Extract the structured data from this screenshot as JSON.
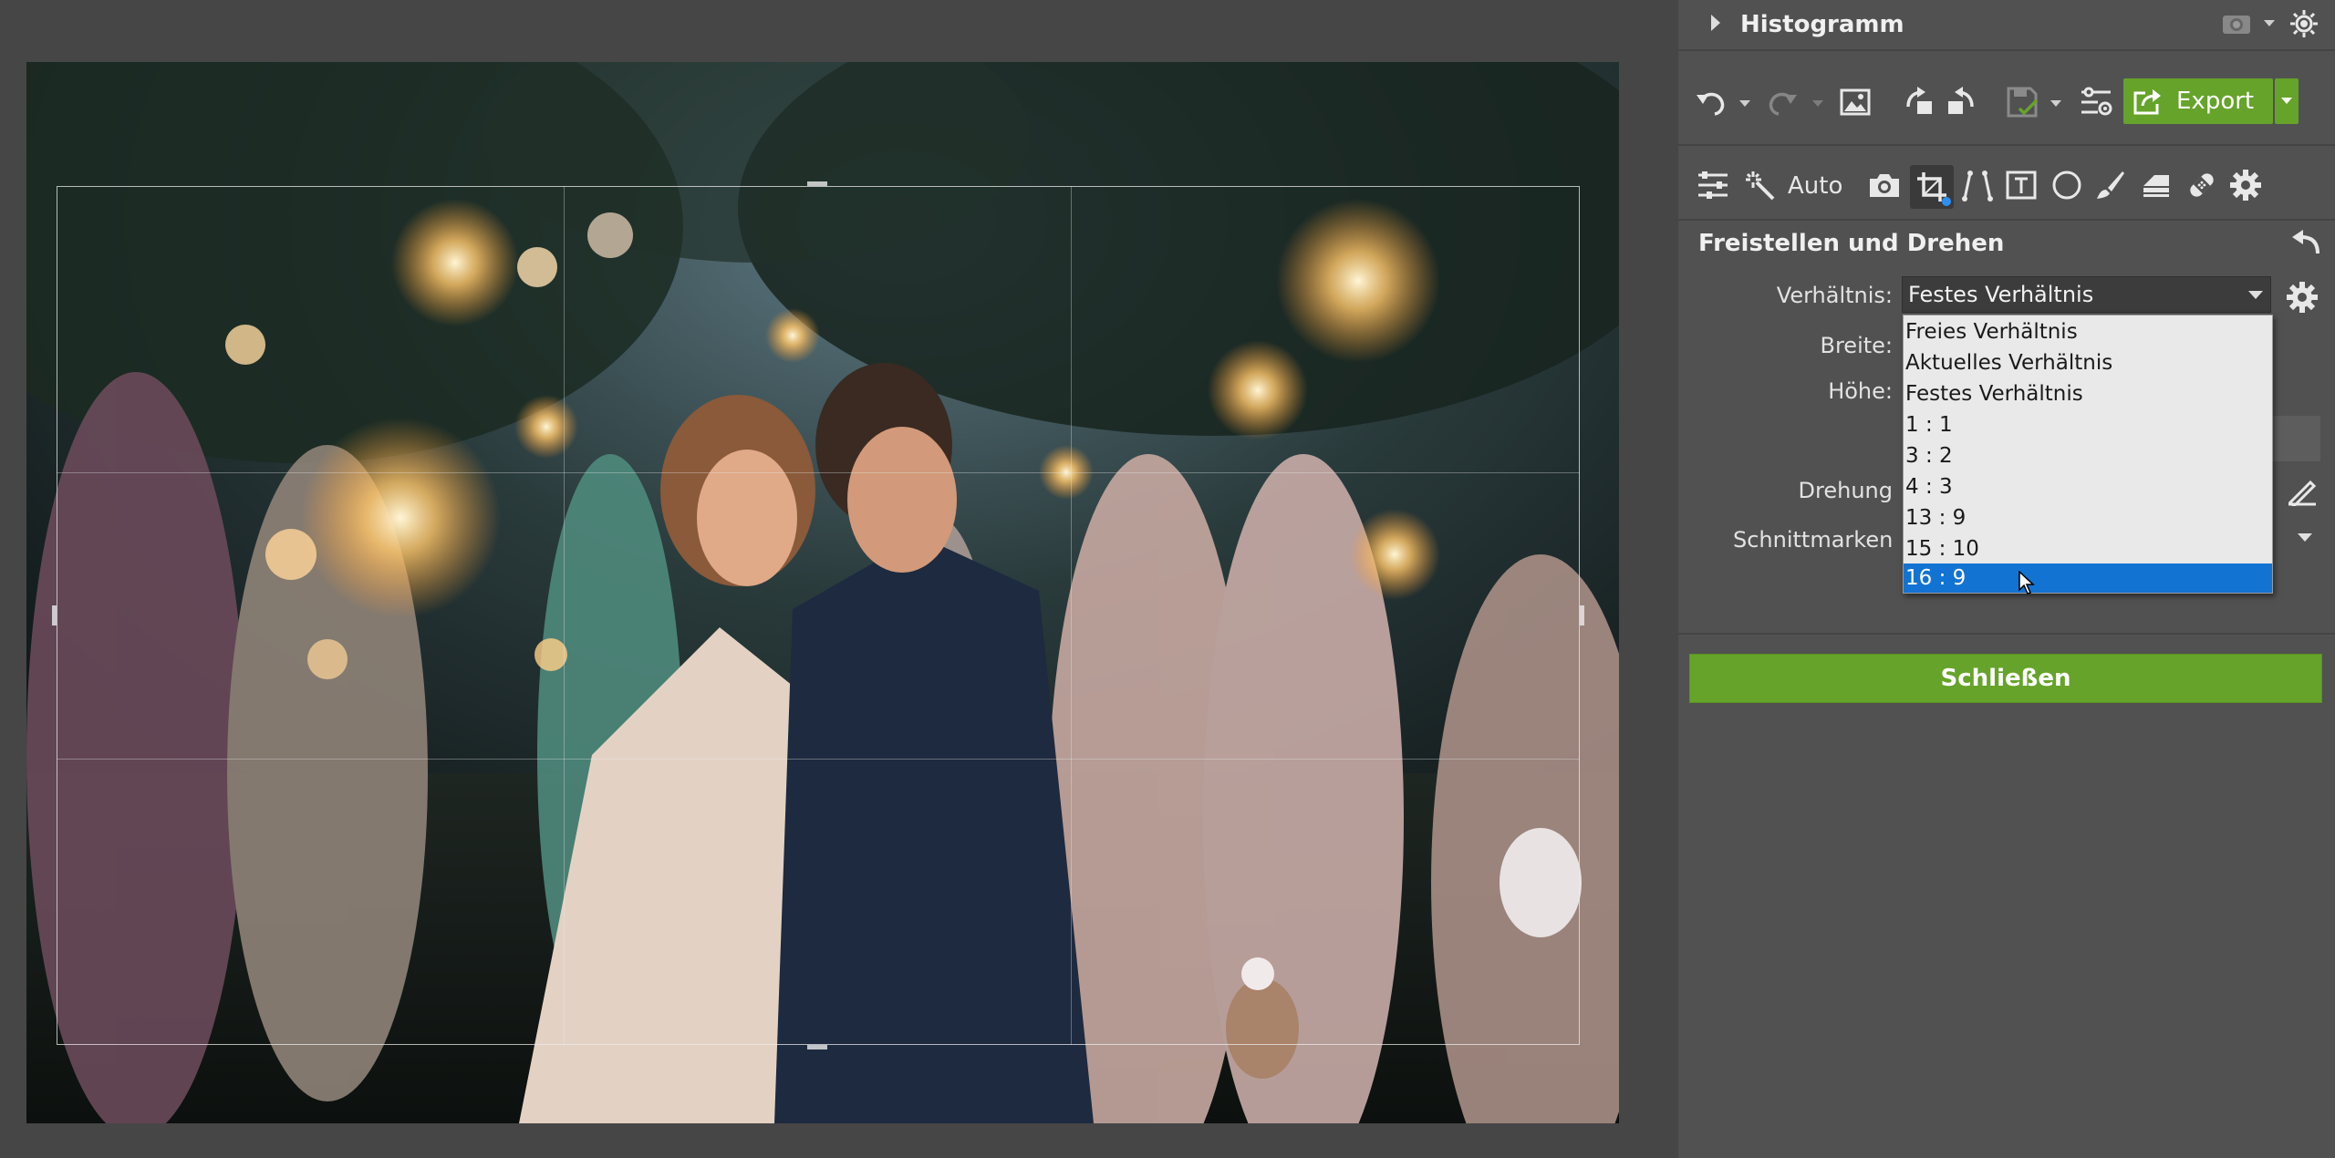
{
  "panel": {
    "histogram_title": "Histogramm",
    "export_label": "Export",
    "auto_label": "Auto",
    "section_title": "Freistellen und Drehen",
    "ratio_label": "Verhältnis:",
    "ratio_value": "Festes Verhältnis",
    "width_label": "Breite:",
    "height_label": "Höhe:",
    "rotation_label": "Drehung",
    "crop_marks_label": "Schnittmarken",
    "close_label": "Schließen"
  },
  "dropdown": {
    "options": [
      "Freies Verhältnis",
      "Aktuelles Verhältnis",
      "Festes Verhältnis",
      "1 : 1",
      "3 : 2",
      "4 : 3",
      "13 : 9",
      "15 : 10",
      "16 : 9"
    ],
    "highlighted": "16 : 9"
  },
  "colors": {
    "accent_green": "#66a32a",
    "selection_blue": "#1273d2",
    "panel_bg": "#515151",
    "canvas_bg": "#464646"
  },
  "icons": [
    "undo-icon",
    "redo-icon",
    "image-icon",
    "rotate-left-icon",
    "rotate-right-icon",
    "save-icon",
    "batch-settings-icon",
    "export-icon",
    "adjustments-icon",
    "auto-wand-icon",
    "camera-icon",
    "crop-icon",
    "perspective-icon",
    "text-icon",
    "circle-mask-icon",
    "brush-icon",
    "eraser-icon",
    "healing-icon",
    "settings-icon",
    "back-arrow-icon",
    "ruler-icon",
    "gear-icon",
    "camera-eye-icon",
    "sun-icon"
  ]
}
